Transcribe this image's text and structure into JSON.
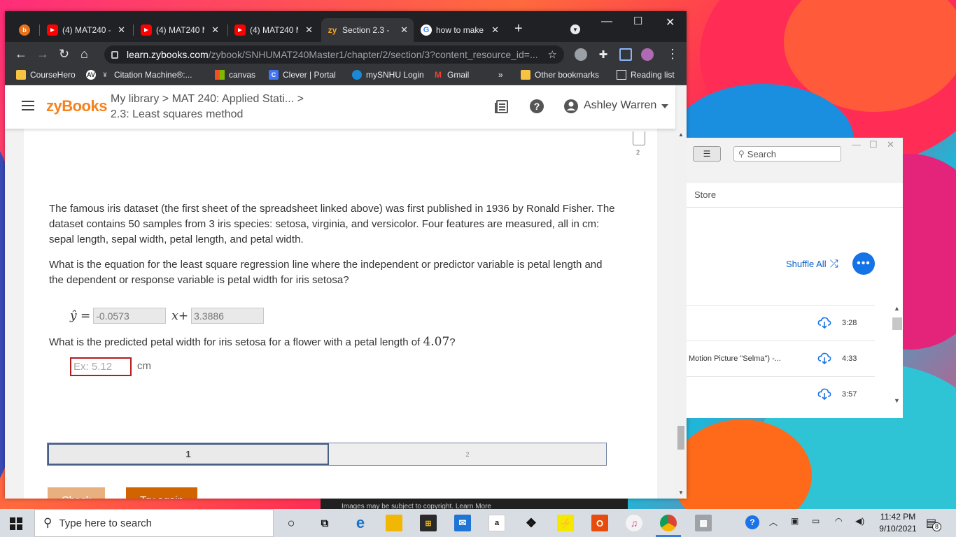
{
  "browser": {
    "tabs": [
      {
        "title": "",
        "favicon": "bing-icon",
        "active": false
      },
      {
        "title": "(4) MAT240 -",
        "favicon": "youtube-icon",
        "active": false
      },
      {
        "title": "(4) MAT240 M",
        "favicon": "youtube-icon",
        "active": false
      },
      {
        "title": "(4) MAT240 M",
        "favicon": "youtube-icon",
        "active": false
      },
      {
        "title": "Section 2.3 -",
        "favicon": "zybooks-icon",
        "active": true
      },
      {
        "title": "how to make",
        "favicon": "google-icon",
        "active": false
      }
    ],
    "new_tab": "+",
    "url_host": "learn.zybooks.com",
    "url_path": "/zybook/SNHUMAT240Master1/chapter/2/section/3?content_resource_id=...",
    "bookmarks": [
      {
        "label": "CourseHero"
      },
      {
        "label": "Citation Machine®:..."
      },
      {
        "label": "canvas"
      },
      {
        "label": "Clever | Portal"
      },
      {
        "label": "mySNHU Login"
      },
      {
        "label": "Gmail"
      }
    ],
    "bookmarks_overflow": "»",
    "other_bookmarks": "Other bookmarks",
    "reading_list": "Reading list"
  },
  "zybooks": {
    "logo": "zyBooks",
    "breadcrumb_line1": "My library > MAT 240: Applied Stati... >",
    "breadcrumb_line2": "2.3: Least squares method",
    "user_name": "Ashley Warren",
    "bookmark_count": "2",
    "paragraph1": "The famous iris dataset (the first sheet of the spreadsheet linked above) was first published in 1936 by Ronald Fisher. The dataset contains 50 samples from 3 iris species: setosa, virginia, and versicolor. Four features are measured, all in cm: sepal length, sepal width, petal length, and petal width.",
    "paragraph2": "What is the equation for the least square regression line where the independent or predictor variable is petal length and the dependent or response variable is petal width for iris setosa?",
    "equation": {
      "lhs": "ŷ =",
      "slope": "-0.0573",
      "x_plus": "x+",
      "intercept": "3.3886"
    },
    "question2_prefix": "What is the predicted petal width for iris setosa for a flower with a petal length of ",
    "question2_value": "4.07",
    "question2_suffix": "?",
    "answer_placeholder": "Ex: 5.12",
    "unit": "cm",
    "progress_steps": [
      "1",
      "2"
    ],
    "check_label": "Check",
    "try_again_label": "Try again"
  },
  "groove": {
    "search_placeholder": "Search",
    "store_label": "Store",
    "shuffle_label": "Shuffle All",
    "more_label": "•••",
    "tracks": [
      {
        "title": "",
        "duration": "3:28"
      },
      {
        "title": "Motion Picture \"Selma\") -...",
        "duration": "4:33"
      },
      {
        "title": "",
        "duration": "3:57"
      }
    ]
  },
  "bing_strip_text": "Images may be subject to copyright. Learn More",
  "taskbar": {
    "search_placeholder": "Type here to search",
    "time": "11:42 PM",
    "date": "9/10/2021",
    "notification_count": "8"
  },
  "colors": {
    "zybooks_orange": "#f5821f",
    "error_red": "#b71c1c",
    "try_again": "#d06500",
    "check_disabled": "#e8b07e",
    "groove_blue": "#1473e6",
    "chrome_dark": "#202124"
  }
}
